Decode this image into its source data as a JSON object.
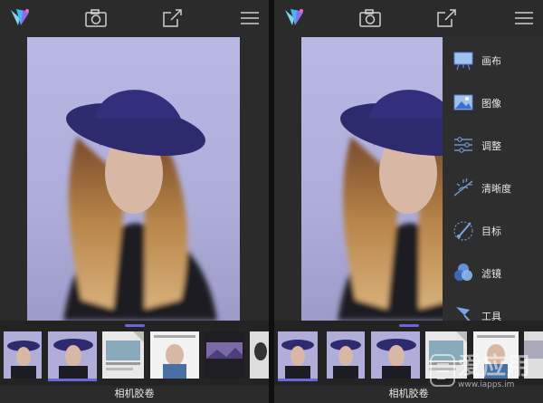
{
  "colors": {
    "accent": "#6b66d9",
    "background": "#2b2b2b",
    "photo_bg": "#b1b0dc"
  },
  "panels": [
    {
      "id": "left",
      "toolbar": [
        "app-logo-icon",
        "camera-icon",
        "share-icon",
        "menu-icon"
      ],
      "strip_label": "相机胶卷"
    },
    {
      "id": "right",
      "toolbar": [
        "app-logo-icon",
        "camera-icon",
        "share-icon",
        "menu-icon"
      ],
      "menu": [
        {
          "label": "画布",
          "icon": "canvas-icon"
        },
        {
          "label": "图像",
          "icon": "image-icon"
        },
        {
          "label": "调整",
          "icon": "sliders-icon"
        },
        {
          "label": "清晰度",
          "icon": "clarity-icon"
        },
        {
          "label": "目标",
          "icon": "target-brush-icon"
        },
        {
          "label": "滤镜",
          "icon": "filter-icon"
        },
        {
          "label": "工具",
          "icon": "tools-icon"
        }
      ],
      "strip_label": "相机胶卷"
    }
  ],
  "watermark": {
    "text": "爱应用",
    "url": "www.iapps.im"
  }
}
